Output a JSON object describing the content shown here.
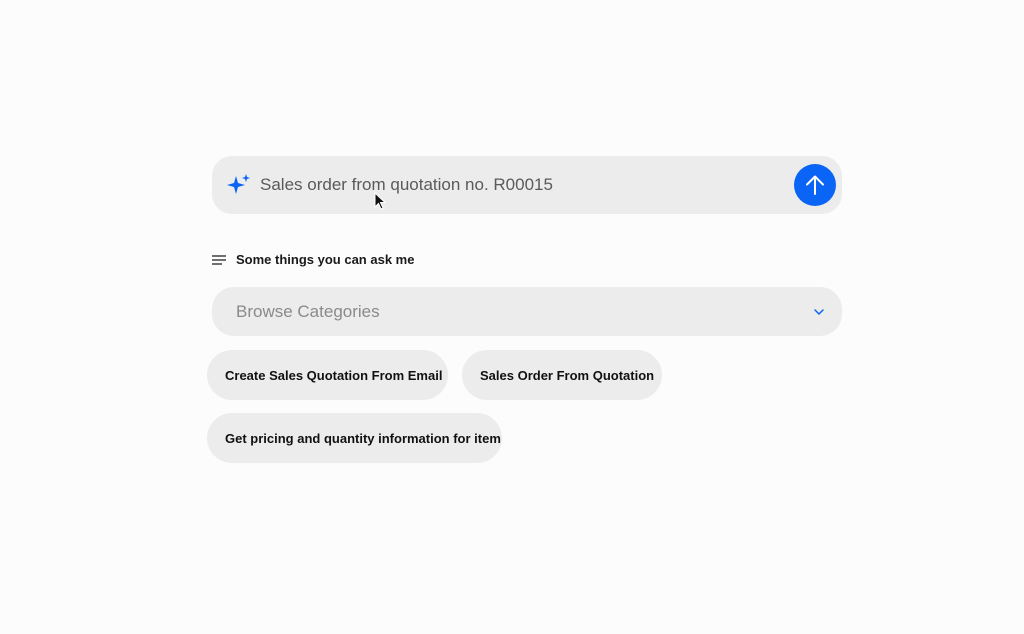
{
  "prompt": {
    "value": "Sales order from quotation no. R00015",
    "sparkle_icon": "sparkle-icon",
    "send_icon": "arrow-up-icon",
    "accent_color": "#0a64f5"
  },
  "suggestions_header": {
    "icon": "lines-icon",
    "text": "Some things you can ask me"
  },
  "browse": {
    "placeholder": "Browse Categories",
    "icon": "chevron-down-icon"
  },
  "chips": [
    {
      "label": "Create Sales Quotation From Email"
    },
    {
      "label": "Sales Order From Quotation"
    },
    {
      "label": "Get pricing and quantity information for item"
    }
  ]
}
